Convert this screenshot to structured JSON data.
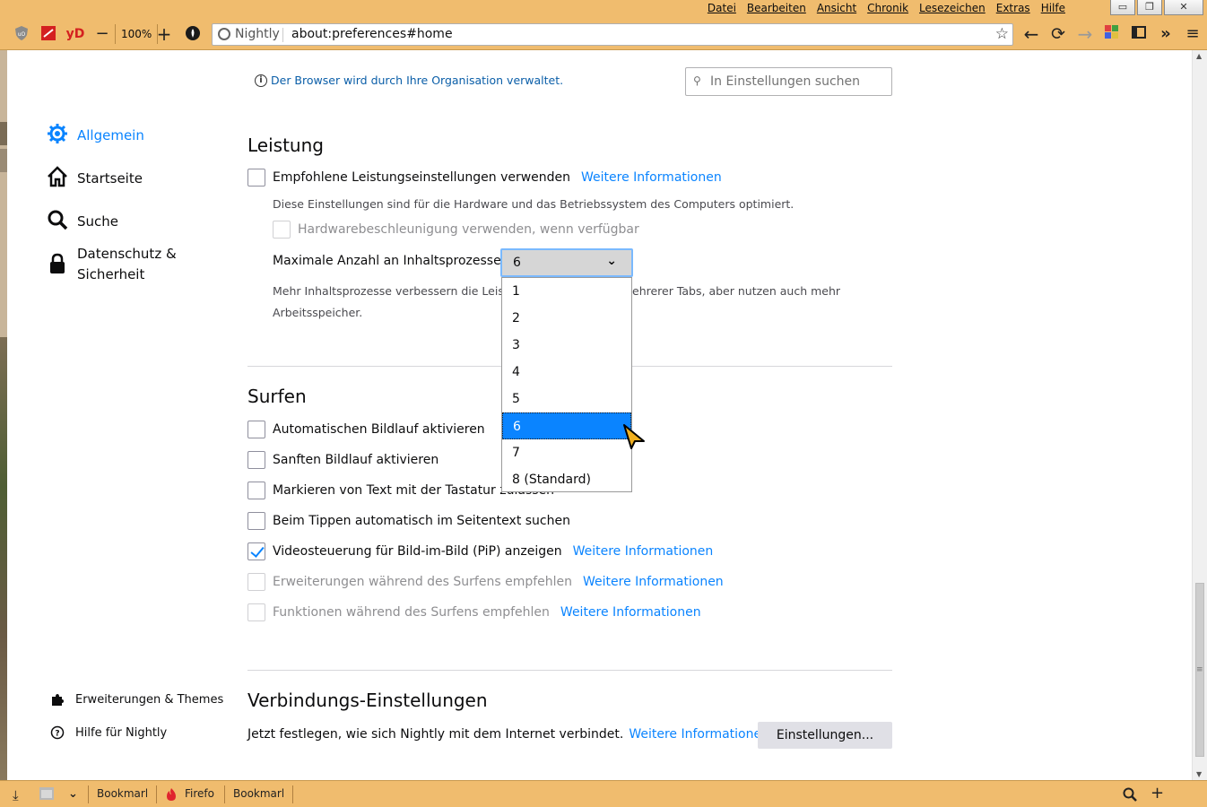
{
  "menubar": {
    "items": [
      "Datei",
      "Bearbeiten",
      "Ansicht",
      "Chronik",
      "Lesezeichen",
      "Extras",
      "Hilfe"
    ]
  },
  "window_controls": {
    "minimize": "▭",
    "restore": "❐",
    "close": "✕"
  },
  "toolbar": {
    "ext_badge": "yD",
    "zoom_out": "−",
    "zoom_level": "100%",
    "zoom_in": "+",
    "identity_label": "Nightly",
    "url": "about:preferences#home"
  },
  "notice": {
    "text": "Der Browser wird durch Ihre Organisation verwaltet."
  },
  "search": {
    "placeholder": "In Einstellungen suchen"
  },
  "sidebar": {
    "items": [
      {
        "label": "Allgemein",
        "icon": "gear-icon",
        "active": true
      },
      {
        "label": "Startseite",
        "icon": "home-icon"
      },
      {
        "label": "Suche",
        "icon": "search-icon"
      },
      {
        "label_line1": "Datenschutz &",
        "label_line2": "Sicherheit",
        "icon": "lock-icon"
      }
    ],
    "footer": [
      {
        "label": "Erweiterungen & Themes",
        "icon": "puzzle-icon"
      },
      {
        "label": "Hilfe für Nightly",
        "icon": "help-icon"
      }
    ]
  },
  "performance": {
    "heading": "Leistung",
    "recommended_label": "Empfohlene Leistungseinstellungen verwenden",
    "recommended_link": "Weitere Informationen",
    "recommended_desc": "Diese Einstellungen sind für die Hardware und das Betriebssystem des Computers optimiert.",
    "hw_accel_label": "Hardwarebeschleunigung verwenden, wenn verfügbar",
    "process_label": "Maximale Anzahl an Inhaltsprozessen",
    "process_value": "6",
    "process_desc_line1": "Mehr Inhaltsprozesse verbessern die Leist",
    "process_desc_line1_tail": "ehrerer Tabs, aber nutzen auch mehr",
    "process_desc_line2": "Arbeitsspeicher.",
    "options": [
      "1",
      "2",
      "3",
      "4",
      "5",
      "6",
      "7",
      "8 (Standard)"
    ],
    "selected_index": 5
  },
  "browsing": {
    "heading": "Surfen",
    "items": [
      {
        "label": "Automatischen Bildlauf aktivieren",
        "checked": false
      },
      {
        "label": "Sanften Bildlauf aktivieren",
        "checked": false
      },
      {
        "label": "Markieren von Text mit der Tastatur zulassen",
        "checked": false
      },
      {
        "label": "Beim Tippen automatisch im Seitentext suchen",
        "checked": false
      },
      {
        "label": "Videosteuerung für Bild-im-Bild (PiP) anzeigen",
        "checked": true,
        "link": "Weitere Informationen"
      },
      {
        "label": "Erweiterungen während des Surfens empfehlen",
        "checked": false,
        "disabled": true,
        "link": "Weitere Informationen"
      },
      {
        "label": "Funktionen während des Surfens empfehlen",
        "checked": false,
        "disabled": true,
        "link": "Weitere Informationen"
      }
    ]
  },
  "connection": {
    "heading": "Verbindungs-Einstellungen",
    "desc": "Jetzt festlegen, wie sich Nightly mit dem Internet verbindet.",
    "link": "Weitere Informationen",
    "button": "Einstellungen..."
  },
  "bottombar": {
    "items": [
      "Bookmark",
      "Firefo",
      "Bookmark"
    ]
  },
  "colors": {
    "chrome": "#f0bc6e",
    "accent": "#0a84ff",
    "link": "#0a5ea8"
  }
}
